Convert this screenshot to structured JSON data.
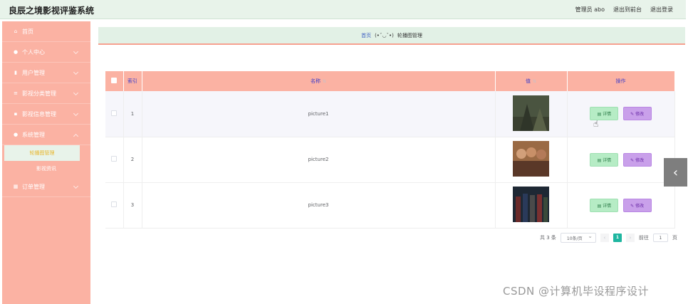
{
  "header": {
    "app_title": "良辰之境影视评鉴系统",
    "user_label": "管理员 abo",
    "back_to_front": "退出到前台",
    "logout": "退出登录"
  },
  "sidebar": {
    "items": [
      {
        "label": "首页",
        "icon": "home-icon"
      },
      {
        "label": "个人中心",
        "icon": "user-icon"
      },
      {
        "label": "用户管理",
        "icon": "chart-icon"
      },
      {
        "label": "影视分类管理",
        "icon": "list-icon"
      },
      {
        "label": "影视信息管理",
        "icon": "grid-icon"
      },
      {
        "label": "系统管理",
        "icon": "pin-icon"
      },
      {
        "label": "订单管理",
        "icon": "grid-icon"
      }
    ],
    "subitems": [
      {
        "label": "轮播图管理"
      },
      {
        "label": "影视资讯"
      }
    ]
  },
  "breadcrumb": {
    "home": "首页",
    "emoticon": "(•ˇ◡ˇ•)",
    "current": "轮播图管理"
  },
  "table": {
    "headers": {
      "index": "索引",
      "name": "名称",
      "value": "值",
      "actions": "操作"
    },
    "rows": [
      {
        "index": "1",
        "name": "picture1",
        "thumb_color": "#46503a"
      },
      {
        "index": "2",
        "name": "picture2",
        "thumb_color": "#8a5a3a"
      },
      {
        "index": "3",
        "name": "picture3",
        "thumb_color": "#2a3440"
      }
    ],
    "detail_label": "详情",
    "edit_label": "修改"
  },
  "pagination": {
    "total": "共 3 条",
    "page_size": "10条/页",
    "current_page": "1",
    "goto_label": "前往",
    "goto_value": "1",
    "page_suffix": "页"
  },
  "watermark": "CSDN @计算机毕设程序设计",
  "colors": {
    "sidebar": "#fbb2a3",
    "header": "#e8f3ea",
    "active_page": "#1fb6a0",
    "detail_button": "#b6ecc5",
    "edit_button": "#c9a0ea"
  }
}
